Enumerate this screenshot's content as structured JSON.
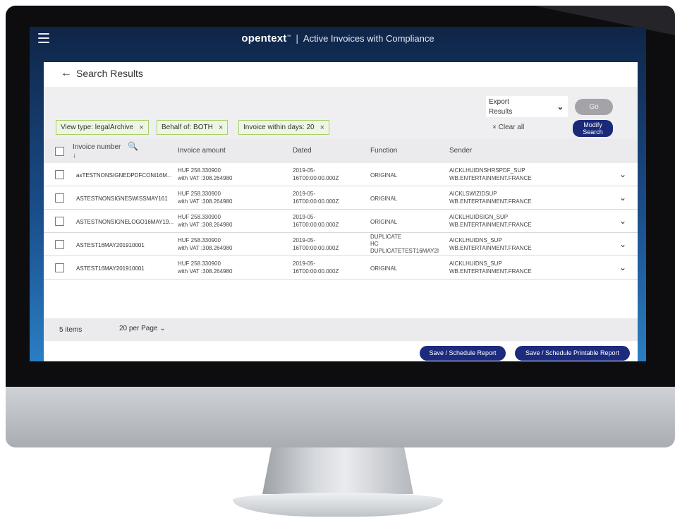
{
  "header": {
    "brand": "opentext",
    "tm": "™",
    "separator": "|",
    "app_title": "Active Invoices with Compliance"
  },
  "page": {
    "back_arrow": "←",
    "title": "Search Results"
  },
  "export": {
    "line1": "Export",
    "line2": "Results",
    "chevron": "⌄",
    "go_label": "Go"
  },
  "filters": {
    "chips": [
      {
        "label": "View type:  legalArchive",
        "close": "×"
      },
      {
        "label": "Behalf of:  BOTH",
        "close": "×"
      },
      {
        "label": "Invoice within days:  20",
        "close": "×"
      }
    ],
    "clear_all": "× Clear all",
    "modify_line1": "Modify",
    "modify_line2": "Search"
  },
  "table": {
    "columns": {
      "invoice_number": "Invoice number",
      "search_icon": "🔍",
      "sort_icon": "↓",
      "invoice_amount": "Invoice amount",
      "dated": "Dated",
      "function": "Function",
      "sender": "Sender"
    },
    "rows": [
      {
        "invoice": "asTESTNONSIGNEDPDFCONt16M...",
        "amount1": "HUF 258.330900",
        "amount2": "with VAT :308.264980",
        "date1": "2019-05-",
        "date2": "16T00:00:00.000Z",
        "function": "ORIGINAL",
        "sender1": "AICKLHUIDNSHRSPDF_SUP",
        "sender2": "WB.ENTERTAINMENT.FRANCE"
      },
      {
        "invoice": "ASTESTNONSIGNESWISSMAY161",
        "amount1": "HUF 258.330900",
        "amount2": "with VAT :308.264980",
        "date1": "2019-05-",
        "date2": "16T00:00:00.000Z",
        "function": "ORIGINAL",
        "sender1": "AICKLSWIZIDSUP",
        "sender2": "WB.ENTERTAINMENT.FRANCE"
      },
      {
        "invoice": "ASTESTNONSIGNELOGO16MAY19...",
        "amount1": "HUF 258.330900",
        "amount2": "with VAT :308.264980",
        "date1": "2019-05-",
        "date2": "16T00:00:00.000Z",
        "function": "ORIGINAL",
        "sender1": "AICKLHUIDSIGN_SUP",
        "sender2": "WB.ENTERTAINMENT.FRANCE"
      },
      {
        "invoice": "ASTEST16MAY201910001",
        "amount1": "HUF 258.330900",
        "amount2": "with VAT :308.264980",
        "date1": "2019-05-",
        "date2": "16T00:00:00.000Z",
        "function_line1": "DUPLICATE",
        "function_line2": "HC",
        "function_line3": "DUPLICATETEST16MAY2I",
        "sender1": "AICKLHUIDNS_SUP",
        "sender2": "WB.ENTERTAINMENT.FRANCE"
      },
      {
        "invoice": "ASTEST16MAY201910001",
        "amount1": "HUF 258.330900",
        "amount2": "with VAT :308.264980",
        "date1": "2019-05-",
        "date2": "16T00:00:00.000Z",
        "function": "ORIGINAL",
        "sender1": "AICKLHUIDNS_SUP",
        "sender2": "WB.ENTERTAINMENT.FRANCE"
      }
    ],
    "expand_icon": "⌄"
  },
  "footer": {
    "count": "5 items",
    "per_page": "20 per Page ⌄"
  },
  "actions": {
    "save_schedule": "Save / Schedule Report",
    "save_schedule_printable": "Save / Schedule Printable Report"
  },
  "colors": {
    "accent": "#1c2b7d",
    "chip_border": "#a6cf6a",
    "chip_bg": "#eef6e3",
    "go_button": "#a3a3a8",
    "screen_gradient_top": "#0f2547",
    "screen_gradient_bottom": "#2a7ec3"
  }
}
